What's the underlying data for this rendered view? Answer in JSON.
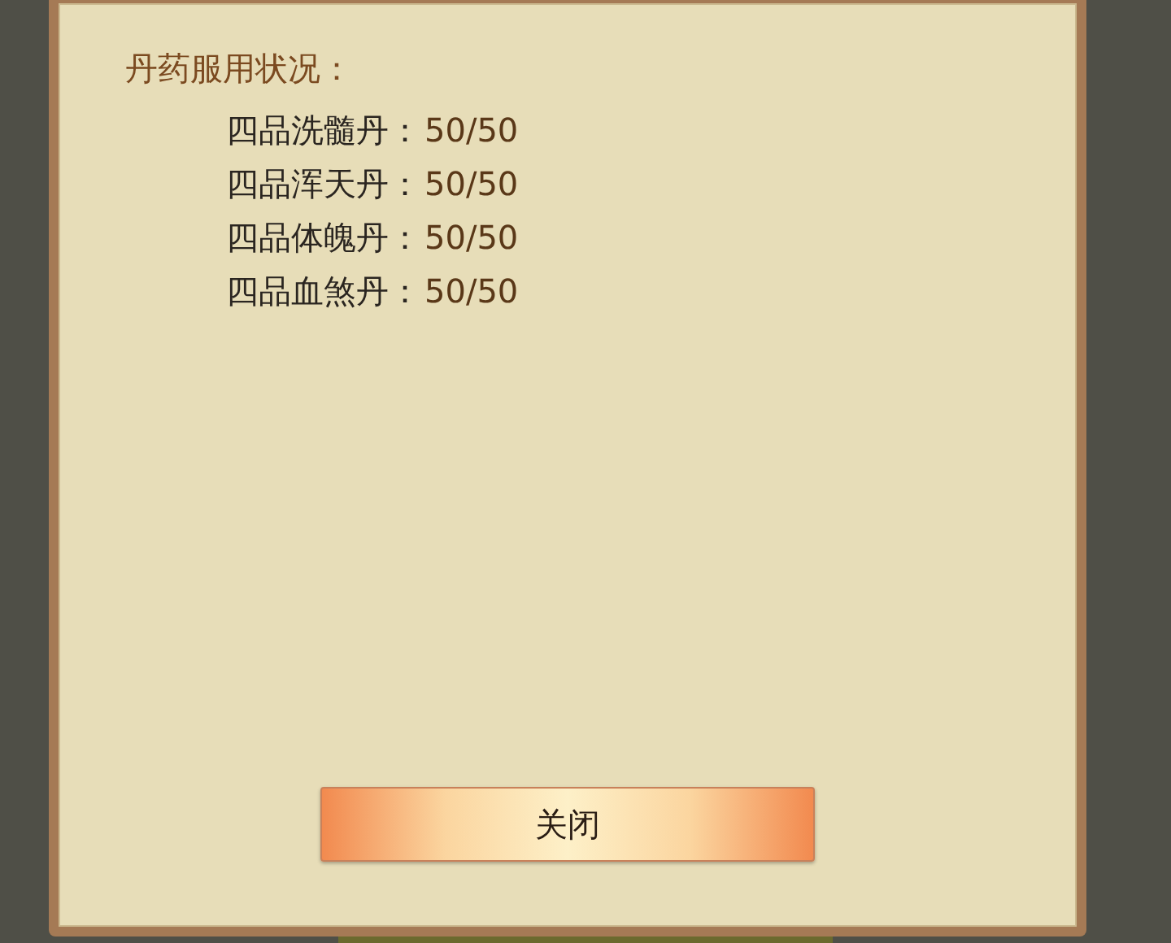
{
  "dialog": {
    "title": "丹药服用状况：",
    "items": [
      {
        "name": "四品洗髓丹：",
        "value": "50/50"
      },
      {
        "name": "四品浑天丹：",
        "value": "50/50"
      },
      {
        "name": "四品体魄丹：",
        "value": "50/50"
      },
      {
        "name": "四品血煞丹：",
        "value": "50/50"
      }
    ],
    "close_button": "关闭"
  }
}
